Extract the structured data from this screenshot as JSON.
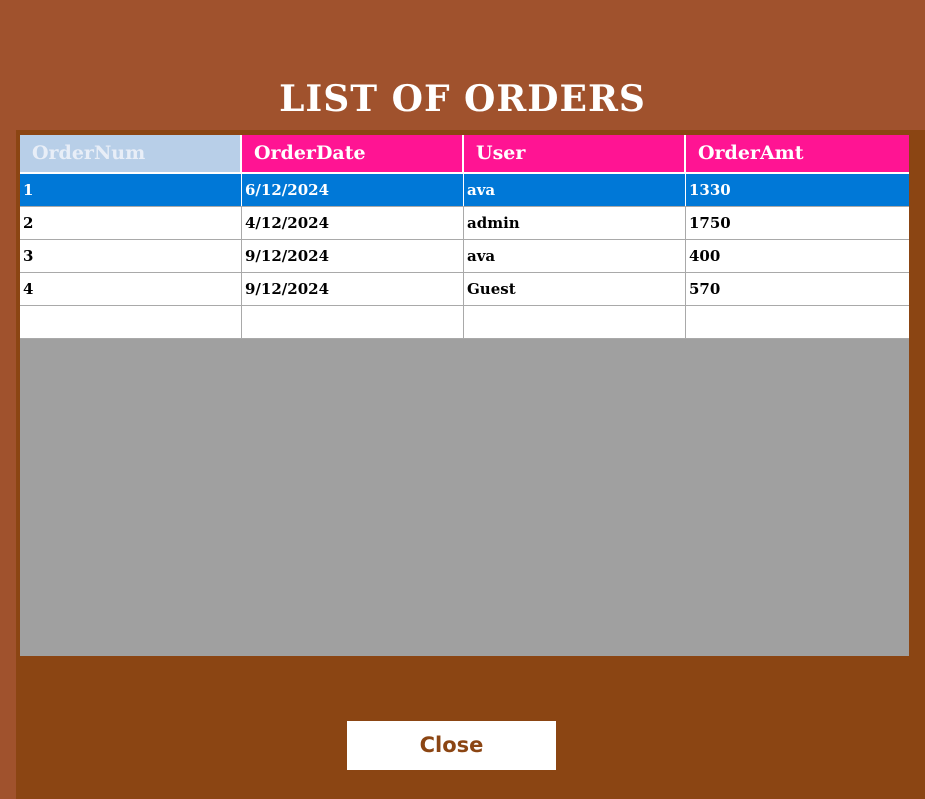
{
  "window": {
    "title": "LIST OF ORDERS"
  },
  "table": {
    "columns": [
      "OrderNum",
      "OrderDate",
      "User",
      "OrderAmt"
    ],
    "rows": [
      [
        "1",
        "6/12/2024",
        "ava",
        "1330"
      ],
      [
        "2",
        "4/12/2024",
        "admin",
        "1750"
      ],
      [
        "3",
        "9/12/2024",
        "ava",
        "400"
      ],
      [
        "4",
        "9/12/2024",
        "Guest",
        "570"
      ],
      [
        "",
        "",
        "",
        ""
      ]
    ],
    "selected_row": 0
  },
  "actions": {
    "close_label": "Close"
  },
  "colors": {
    "background": "#a0522d",
    "panel": "#8b4513",
    "header_pink": "#ff1493",
    "header_first": "#b8cfe8",
    "selection": "#0078d7",
    "grid_empty": "#a0a0a0"
  }
}
